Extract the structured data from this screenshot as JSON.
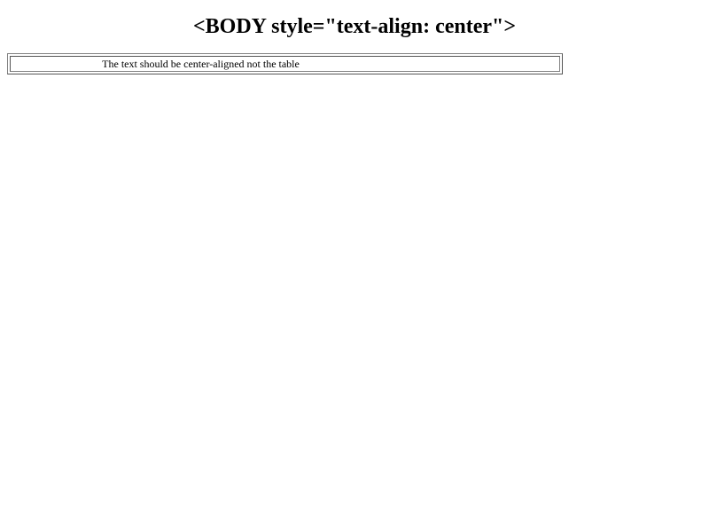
{
  "page": {
    "heading": "<BODY style=\"text-align: center\">",
    "table_cell_text": "The text should be center-aligned not the table"
  }
}
